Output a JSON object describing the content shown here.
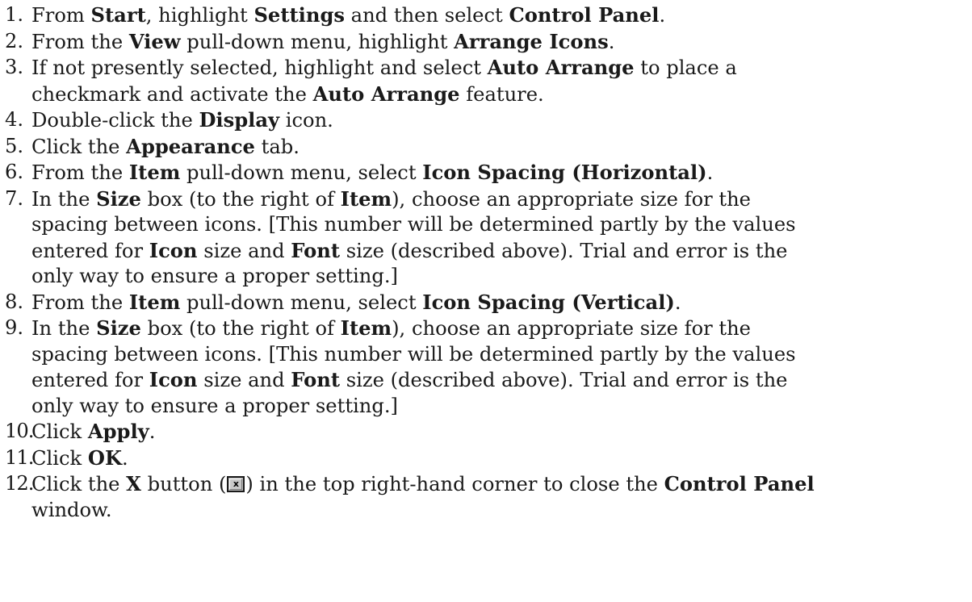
{
  "steps": [
    {
      "num": "1.",
      "lines": [
        [
          {
            "t": "From "
          },
          {
            "t": "Start",
            "b": true
          },
          {
            "t": ", highlight "
          },
          {
            "t": "Settings",
            "b": true
          },
          {
            "t": " and then select "
          },
          {
            "t": "Control Panel",
            "b": true
          },
          {
            "t": "."
          }
        ]
      ]
    },
    {
      "num": "2.",
      "lines": [
        [
          {
            "t": "From the "
          },
          {
            "t": "View",
            "b": true
          },
          {
            "t": " pull-down menu, highlight "
          },
          {
            "t": "Arrange Icons",
            "b": true
          },
          {
            "t": "."
          }
        ]
      ]
    },
    {
      "num": "3.",
      "lines": [
        [
          {
            "t": "If not presently selected, highlight and select "
          },
          {
            "t": "Auto Arrange",
            "b": true
          },
          {
            "t": " to place a"
          }
        ],
        [
          {
            "t": "checkmark and activate the "
          },
          {
            "t": "Auto Arrange",
            "b": true
          },
          {
            "t": " feature."
          }
        ]
      ]
    },
    {
      "num": "4.",
      "lines": [
        [
          {
            "t": "Double-click the "
          },
          {
            "t": "Display",
            "b": true
          },
          {
            "t": " icon."
          }
        ]
      ]
    },
    {
      "num": "5.",
      "lines": [
        [
          {
            "t": "Click the "
          },
          {
            "t": "Appearance",
            "b": true
          },
          {
            "t": " tab."
          }
        ]
      ]
    },
    {
      "num": "6.",
      "lines": [
        [
          {
            "t": "From the "
          },
          {
            "t": "Item",
            "b": true
          },
          {
            "t": " pull-down menu, select "
          },
          {
            "t": "Icon Spacing (Horizontal)",
            "b": true
          },
          {
            "t": "."
          }
        ]
      ]
    },
    {
      "num": "7.",
      "lines": [
        [
          {
            "t": "In the "
          },
          {
            "t": "Size",
            "b": true
          },
          {
            "t": " box (to the right of "
          },
          {
            "t": "Item",
            "b": true
          },
          {
            "t": "), choose an appropriate size for the"
          }
        ],
        [
          {
            "t": "spacing between icons. [This number will be determined partly by the values"
          }
        ],
        [
          {
            "t": "entered for "
          },
          {
            "t": "Icon",
            "b": true
          },
          {
            "t": " size and "
          },
          {
            "t": "Font",
            "b": true
          },
          {
            "t": " size (described above). Trial and error is the"
          }
        ],
        [
          {
            "t": "only way to ensure a proper setting.]"
          }
        ]
      ]
    },
    {
      "num": "8.",
      "lines": [
        [
          {
            "t": "From the "
          },
          {
            "t": "Item",
            "b": true
          },
          {
            "t": " pull-down menu, select "
          },
          {
            "t": "Icon Spacing (Vertical)",
            "b": true
          },
          {
            "t": "."
          }
        ]
      ]
    },
    {
      "num": "9.",
      "lines": [
        [
          {
            "t": "In the "
          },
          {
            "t": "Size",
            "b": true
          },
          {
            "t": " box (to the right of "
          },
          {
            "t": "Item",
            "b": true
          },
          {
            "t": "), choose an appropriate size for the"
          }
        ],
        [
          {
            "t": "spacing between icons. [This number will be determined partly by the values"
          }
        ],
        [
          {
            "t": "entered for "
          },
          {
            "t": "Icon",
            "b": true
          },
          {
            "t": " size and "
          },
          {
            "t": "Font",
            "b": true
          },
          {
            "t": " size (described above). Trial and error is the"
          }
        ],
        [
          {
            "t": "only way to ensure a proper setting.]"
          }
        ]
      ]
    },
    {
      "num": "10.",
      "lines": [
        [
          {
            "t": "Click "
          },
          {
            "t": "Apply",
            "b": true
          },
          {
            "t": "."
          }
        ]
      ]
    },
    {
      "num": "11.",
      "lines": [
        [
          {
            "t": "Click "
          },
          {
            "t": "OK",
            "b": true
          },
          {
            "t": "."
          }
        ]
      ]
    },
    {
      "num": "12.",
      "lines": [
        [
          {
            "t": "Click the "
          },
          {
            "t": "X",
            "b": true
          },
          {
            "t": " button ("
          },
          {
            "icon": "close-button-icon",
            "glyph": "x"
          },
          {
            "t": ") in the top right-hand corner to close the "
          },
          {
            "t": "Control Panel",
            "b": true
          }
        ],
        [
          {
            "t": "window."
          }
        ]
      ]
    }
  ]
}
